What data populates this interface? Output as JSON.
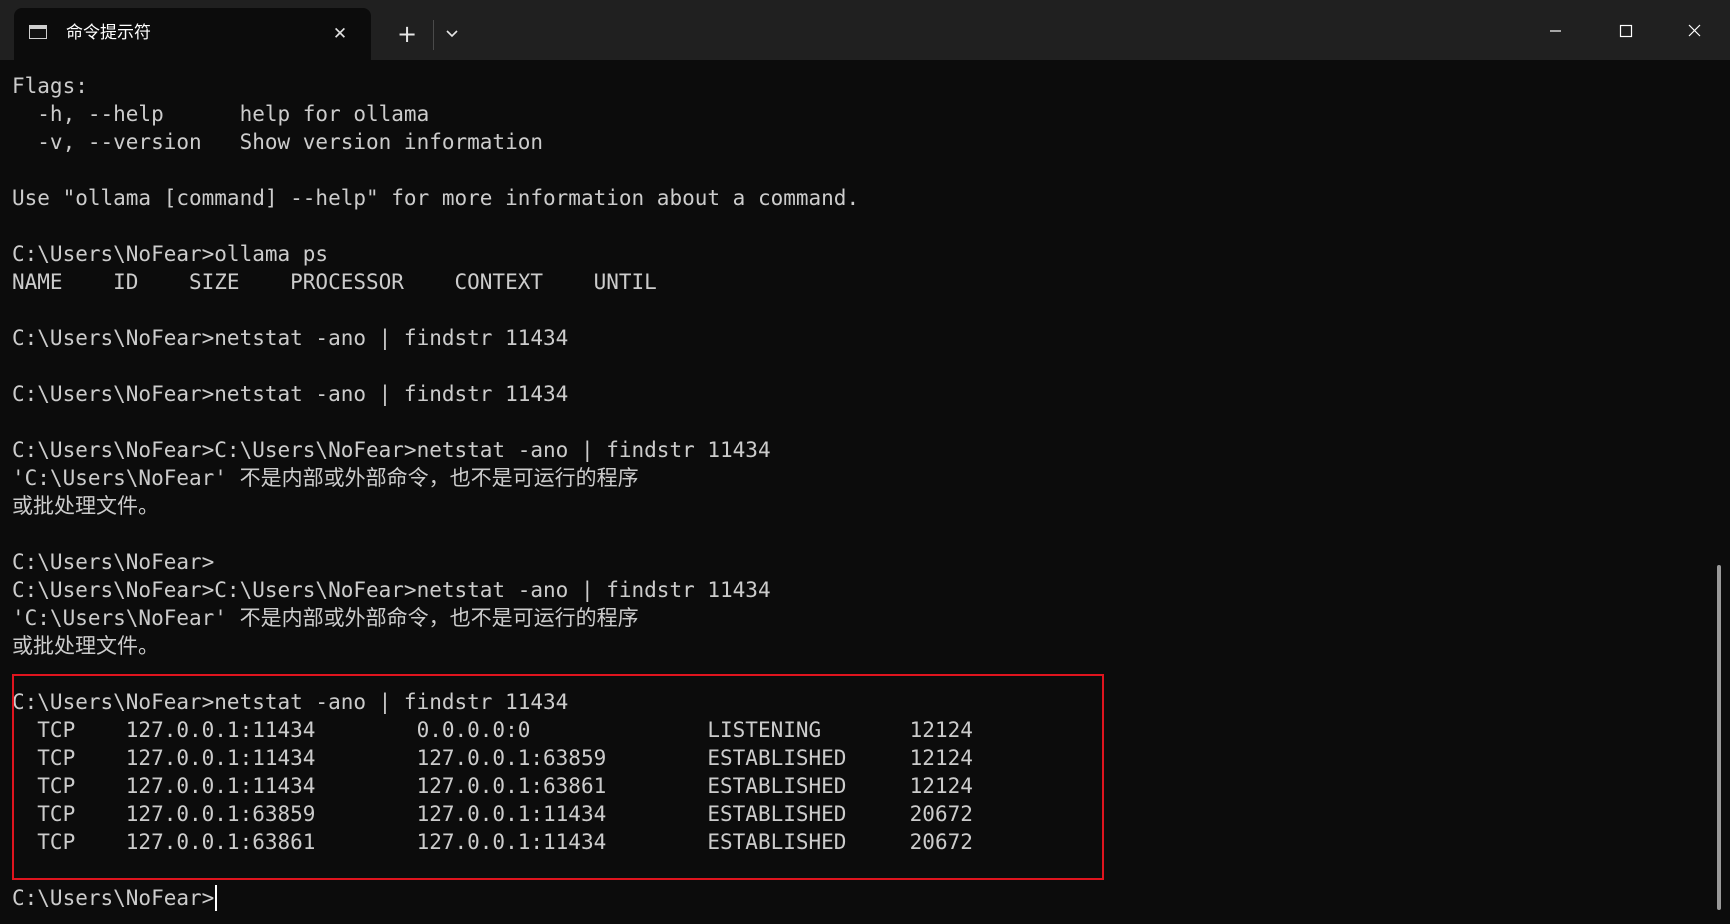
{
  "window": {
    "tab_title": "命令提示符",
    "tab_icon": "terminal-icon",
    "tab_close": "✕",
    "new_tab": "+",
    "dropdown_icon": "chevron-down-icon",
    "minimize_icon": "minimize-icon",
    "maximize_icon": "maximize-icon",
    "close_icon": "close-icon"
  },
  "terminal": {
    "lines": [
      "Flags:",
      "  -h, --help      help for ollama",
      "  -v, --version   Show version information",
      "",
      "Use \"ollama [command] --help\" for more information about a command.",
      "",
      "C:\\Users\\NoFear>ollama ps",
      "NAME    ID    SIZE    PROCESSOR    CONTEXT    UNTIL",
      "",
      "C:\\Users\\NoFear>netstat -ano | findstr 11434",
      "",
      "C:\\Users\\NoFear>netstat -ano | findstr 11434",
      "",
      "C:\\Users\\NoFear>C:\\Users\\NoFear>netstat -ano | findstr 11434",
      "'C:\\Users\\NoFear' 不是内部或外部命令，也不是可运行的程序",
      "或批处理文件。",
      "",
      "C:\\Users\\NoFear>",
      "C:\\Users\\NoFear>C:\\Users\\NoFear>netstat -ano | findstr 11434",
      "'C:\\Users\\NoFear' 不是内部或外部命令，也不是可运行的程序",
      "或批处理文件。",
      "",
      "C:\\Users\\NoFear>netstat -ano | findstr 11434",
      "  TCP    127.0.0.1:11434        0.0.0.0:0              LISTENING       12124",
      "  TCP    127.0.0.1:11434        127.0.0.1:63859        ESTABLISHED     12124",
      "  TCP    127.0.0.1:11434        127.0.0.1:63861        ESTABLISHED     12124",
      "  TCP    127.0.0.1:63859        127.0.0.1:11434        ESTABLISHED     20672",
      "  TCP    127.0.0.1:63861        127.0.0.1:11434        ESTABLISHED     20672",
      ""
    ],
    "prompt": "C:\\Users\\NoFear>"
  },
  "colors": {
    "background": "#0c0c0c",
    "titlebar": "#202020",
    "text": "#cccccc",
    "highlight_border": "#e0141e"
  }
}
